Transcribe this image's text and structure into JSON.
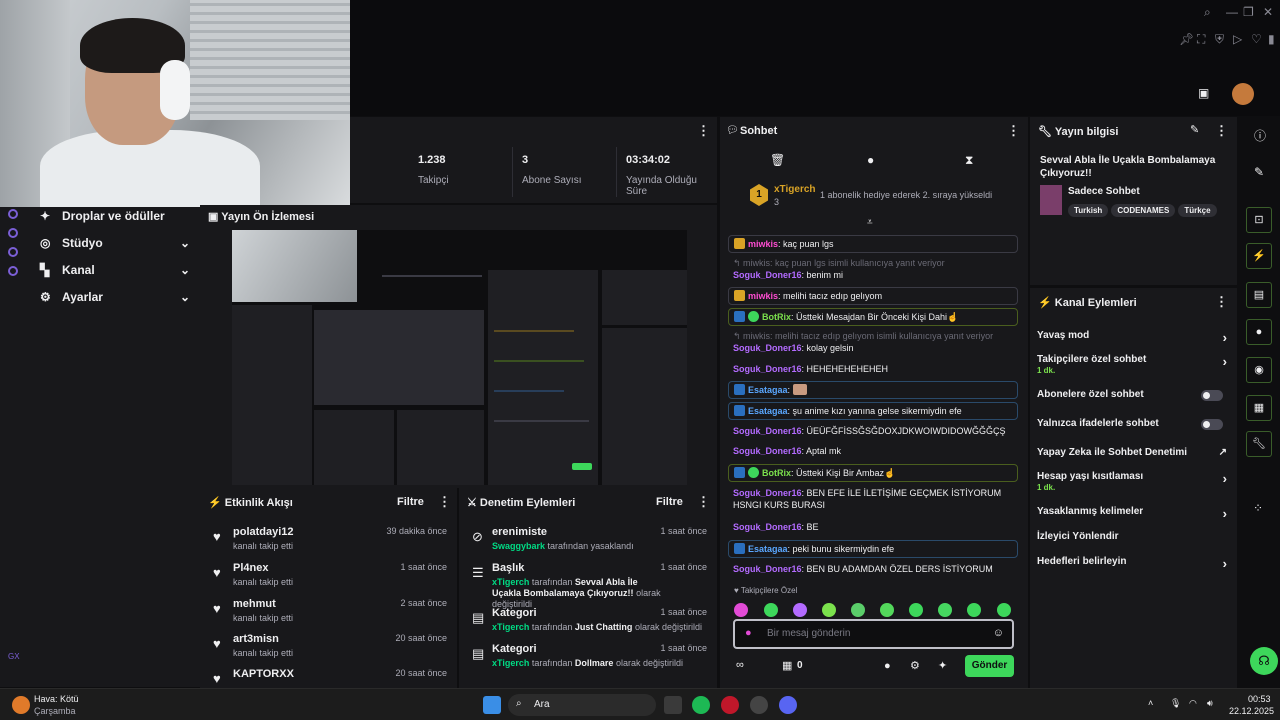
{
  "stats": [
    {
      "value": "1.238",
      "label": "Takipçi"
    },
    {
      "value": "3",
      "label": "Abone Sayısı"
    },
    {
      "value": "03:34:02",
      "label": "Yayında Olduğu Süre"
    }
  ],
  "nav": {
    "items": [
      {
        "label": "Droplar ve ödüller"
      },
      {
        "label": "Stüdyo"
      },
      {
        "label": "Kanal"
      },
      {
        "label": "Ayarlar"
      }
    ],
    "gx": "GX"
  },
  "preview": {
    "title": "Yayın Ön İzlemesi"
  },
  "activity": {
    "title": "Etkinlik Akışı",
    "filter": "Filtre",
    "events": [
      {
        "name": "polatdayi12",
        "sub": "kanalı takip etti",
        "time": "39 dakika önce"
      },
      {
        "name": "Pl4nex",
        "sub": "kanalı takip etti",
        "time": "1 saat önce"
      },
      {
        "name": "mehmut",
        "sub": "kanalı takip etti",
        "time": "2 saat önce"
      },
      {
        "name": "art3misn",
        "sub": "kanalı takip etti",
        "time": "20 saat önce"
      },
      {
        "name": "KAPTORXX",
        "sub": "",
        "time": "20 saat önce"
      }
    ]
  },
  "moderation": {
    "title": "Denetim Eylemleri",
    "filter": "Filtre",
    "events": [
      {
        "name": "erenimiste",
        "actor": "Swaggybark",
        "text": "tarafından yasaklandı",
        "time": "1 saat önce"
      },
      {
        "name": "Başlık",
        "actor": "xTigerch",
        "text": "tarafından",
        "highlight": "Sevval Abla İle Uçakla Bombalamaya Çıkıyoruz!!",
        "tail": "olarak değiştirildi",
        "time": "1 saat önce"
      },
      {
        "name": "Kategori",
        "actor": "xTigerch",
        "text": "tarafından",
        "highlight": "Just Chatting",
        "tail": "olarak değiştirildi",
        "time": "1 saat önce"
      },
      {
        "name": "Kategori",
        "actor": "xTigerch",
        "text": "tarafından",
        "highlight": "Dollmare",
        "tail": "olarak değiştirildi",
        "time": "1 saat önce"
      }
    ]
  },
  "chat": {
    "title": "Sohbet",
    "hype_user": "xTigerch",
    "hype_count": "3",
    "hype_text": "1 abonelik hediye ederek 2. sıraya yükseldi",
    "messages": [
      {
        "type": "hl",
        "user": "miwkis",
        "color": "#ff4dd2",
        "text": ": kaç puan lgs"
      },
      {
        "type": "reply",
        "text": "↰ miwkis: kaç puan lgs isimli kullanıcıya yanıt veriyor"
      },
      {
        "type": "plain",
        "user": "Soguk_Doner16",
        "color": "#b36bff",
        "text": ": benim mi"
      },
      {
        "type": "hl",
        "user": "miwkis",
        "color": "#ff4dd2",
        "text": ": melihi tacız edıp gelıyom"
      },
      {
        "type": "bot",
        "user": "BotRix",
        "color": "#7be14d",
        "text": ": Üstteki Mesajdan Bir Önceki Kişi Dahi☝"
      },
      {
        "type": "reply",
        "text": "↰ miwkis: melihi tacız edıp gelıyom isimli kullanıcıya yanıt veriyor"
      },
      {
        "type": "plain",
        "user": "Soguk_Doner16",
        "color": "#b36bff",
        "text": ": kolay gelsin"
      },
      {
        "type": "plain",
        "user": "Soguk_Doner16",
        "color": "#b36bff",
        "text": ": HEHEHEHEHEHEH"
      },
      {
        "type": "esa",
        "user": "Esatagaa",
        "color": "#5aa7ff",
        "text": ": "
      },
      {
        "type": "esa",
        "user": "Esatagaa",
        "color": "#5aa7ff",
        "text": ": şu anime kızı yanına gelse sikermiydin efe"
      },
      {
        "type": "plain",
        "user": "Soguk_Doner16",
        "color": "#b36bff",
        "text": ": ÜEÜFĞFİSSĞSĞDOXJDKWOIWDIDOWĞĞĞÇŞ"
      },
      {
        "type": "plain",
        "user": "Soguk_Doner16",
        "color": "#b36bff",
        "text": ": Aptal mk"
      },
      {
        "type": "bot",
        "user": "BotRix",
        "color": "#7be14d",
        "text": ": Üstteki Kişi Bir Ambaz☝"
      },
      {
        "type": "plain",
        "user": "Soguk_Doner16",
        "color": "#b36bff",
        "text": ": BEN EFE İLE İLETİŞİME GEÇMEK İSTİYORUM HSNGI KURS BURASI"
      },
      {
        "type": "plain",
        "user": "Soguk_Doner16",
        "color": "#b36bff",
        "text": ": BE"
      },
      {
        "type": "esa",
        "user": "Esatagaa",
        "color": "#5aa7ff",
        "text": ": peki bunu sikermiydin efe"
      },
      {
        "type": "plain",
        "user": "Soguk_Doner16",
        "color": "#b36bff",
        "text": ": BEN BU ADAMDAN ÖZEL DERS İSTİYORUM"
      }
    ],
    "followers_only": "Takipçilere Özel",
    "placeholder": "Bir mesaj gönderin",
    "points": "0",
    "send": "Gönder"
  },
  "info": {
    "title": "Yayın bilgisi",
    "stream_title": "Sevval Abla İle Uçakla Bombalamaya Çıkıyoruz!!",
    "category": "Sadece Sohbet",
    "tags": [
      "Turkish",
      "CODENAMES",
      "Türkçe"
    ]
  },
  "channel_actions": {
    "title": "Kanal Eylemleri",
    "items": [
      {
        "label": "Yavaş mod",
        "sub": "",
        "kind": "arrow"
      },
      {
        "label": "Takipçilere özel sohbet",
        "sub": "1 dk.",
        "kind": "arrow"
      },
      {
        "label": "Abonelere özel sohbet",
        "sub": "",
        "kind": "toggle"
      },
      {
        "label": "Yalnızca ifadelerle sohbet",
        "sub": "",
        "kind": "toggle"
      },
      {
        "label": "Yapay Zeka ile Sohbet Denetimi",
        "sub": "",
        "kind": "ext"
      },
      {
        "label": "Hesap yaşı kısıtlaması",
        "sub": "1 dk.",
        "kind": "arrow"
      },
      {
        "label": "Yasaklanmış kelimeler",
        "sub": "",
        "kind": "arrow"
      },
      {
        "label": "İzleyici Yönlendir",
        "sub": "",
        "kind": "none"
      },
      {
        "label": "Hedefleri belirleyin",
        "sub": "",
        "kind": "arrow"
      }
    ]
  },
  "taskbar": {
    "weather": "Hava: Kötü",
    "weather_day": "Çarşamba",
    "search": "Ara",
    "time": "00:53",
    "date": "22.12.2025"
  }
}
